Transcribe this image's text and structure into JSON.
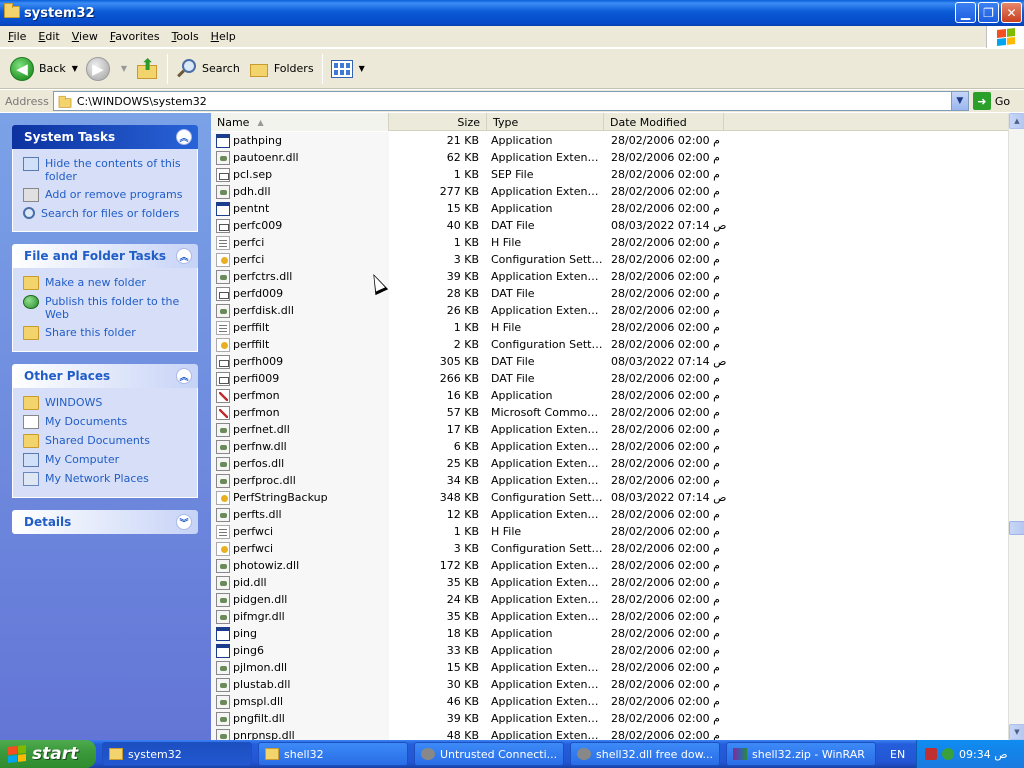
{
  "window": {
    "title": "system32"
  },
  "menu": [
    "File",
    "Edit",
    "View",
    "Favorites",
    "Tools",
    "Help"
  ],
  "toolbar": {
    "back_label": "Back",
    "search_label": "Search",
    "folders_label": "Folders"
  },
  "address": {
    "label": "Address",
    "value": "C:\\WINDOWS\\system32",
    "go_label": "Go"
  },
  "taskpane": {
    "system_tasks": {
      "title": "System Tasks",
      "items": [
        "Hide the contents of this folder",
        "Add or remove programs",
        "Search for files or folders"
      ]
    },
    "file_folder_tasks": {
      "title": "File and Folder Tasks",
      "items": [
        "Make a new folder",
        "Publish this folder to the Web",
        "Share this folder"
      ]
    },
    "other_places": {
      "title": "Other Places",
      "items": [
        "WINDOWS",
        "My Documents",
        "Shared Documents",
        "My Computer",
        "My Network Places"
      ]
    },
    "details": {
      "title": "Details"
    }
  },
  "columns": {
    "name": "Name",
    "size": "Size",
    "type": "Type",
    "date": "Date Modified"
  },
  "files": [
    {
      "icon": "app",
      "name": "pathping",
      "size": "21 KB",
      "type": "Application",
      "date": "28/02/2006 02:00 م"
    },
    {
      "icon": "dll",
      "name": "pautoenr.dll",
      "size": "62 KB",
      "type": "Application Extension",
      "date": "28/02/2006 02:00 م"
    },
    {
      "icon": "gen",
      "name": "pcl.sep",
      "size": "1 KB",
      "type": "SEP File",
      "date": "28/02/2006 02:00 م"
    },
    {
      "icon": "dll",
      "name": "pdh.dll",
      "size": "277 KB",
      "type": "Application Extension",
      "date": "28/02/2006 02:00 م"
    },
    {
      "icon": "app",
      "name": "pentnt",
      "size": "15 KB",
      "type": "Application",
      "date": "28/02/2006 02:00 م"
    },
    {
      "icon": "gen",
      "name": "perfc009",
      "size": "40 KB",
      "type": "DAT File",
      "date": "08/03/2022 07:14 ص"
    },
    {
      "icon": "txt",
      "name": "perfci",
      "size": "1 KB",
      "type": "H File",
      "date": "28/02/2006 02:00 م"
    },
    {
      "icon": "ini",
      "name": "perfci",
      "size": "3 KB",
      "type": "Configuration Settings",
      "date": "28/02/2006 02:00 م"
    },
    {
      "icon": "dll",
      "name": "perfctrs.dll",
      "size": "39 KB",
      "type": "Application Extension",
      "date": "28/02/2006 02:00 م"
    },
    {
      "icon": "gen",
      "name": "perfd009",
      "size": "28 KB",
      "type": "DAT File",
      "date": "28/02/2006 02:00 م"
    },
    {
      "icon": "dll",
      "name": "perfdisk.dll",
      "size": "26 KB",
      "type": "Application Extension",
      "date": "28/02/2006 02:00 م"
    },
    {
      "icon": "txt",
      "name": "perffilt",
      "size": "1 KB",
      "type": "H File",
      "date": "28/02/2006 02:00 م"
    },
    {
      "icon": "ini",
      "name": "perffilt",
      "size": "2 KB",
      "type": "Configuration Settings",
      "date": "28/02/2006 02:00 م"
    },
    {
      "icon": "gen",
      "name": "perfh009",
      "size": "305 KB",
      "type": "DAT File",
      "date": "08/03/2022 07:14 ص"
    },
    {
      "icon": "gen",
      "name": "perfi009",
      "size": "266 KB",
      "type": "DAT File",
      "date": "28/02/2006 02:00 م"
    },
    {
      "icon": "msc",
      "name": "perfmon",
      "size": "16 KB",
      "type": "Application",
      "date": "28/02/2006 02:00 م"
    },
    {
      "icon": "msc",
      "name": "perfmon",
      "size": "57 KB",
      "type": "Microsoft Common ...",
      "date": "28/02/2006 02:00 م"
    },
    {
      "icon": "dll",
      "name": "perfnet.dll",
      "size": "17 KB",
      "type": "Application Extension",
      "date": "28/02/2006 02:00 م"
    },
    {
      "icon": "dll",
      "name": "perfnw.dll",
      "size": "6 KB",
      "type": "Application Extension",
      "date": "28/02/2006 02:00 م"
    },
    {
      "icon": "dll",
      "name": "perfos.dll",
      "size": "25 KB",
      "type": "Application Extension",
      "date": "28/02/2006 02:00 م"
    },
    {
      "icon": "dll",
      "name": "perfproc.dll",
      "size": "34 KB",
      "type": "Application Extension",
      "date": "28/02/2006 02:00 م"
    },
    {
      "icon": "ini",
      "name": "PerfStringBackup",
      "size": "348 KB",
      "type": "Configuration Settings",
      "date": "08/03/2022 07:14 ص"
    },
    {
      "icon": "dll",
      "name": "perfts.dll",
      "size": "12 KB",
      "type": "Application Extension",
      "date": "28/02/2006 02:00 م"
    },
    {
      "icon": "txt",
      "name": "perfwci",
      "size": "1 KB",
      "type": "H File",
      "date": "28/02/2006 02:00 م"
    },
    {
      "icon": "ini",
      "name": "perfwci",
      "size": "3 KB",
      "type": "Configuration Settings",
      "date": "28/02/2006 02:00 م"
    },
    {
      "icon": "dll",
      "name": "photowiz.dll",
      "size": "172 KB",
      "type": "Application Extension",
      "date": "28/02/2006 02:00 م"
    },
    {
      "icon": "dll",
      "name": "pid.dll",
      "size": "35 KB",
      "type": "Application Extension",
      "date": "28/02/2006 02:00 م"
    },
    {
      "icon": "dll",
      "name": "pidgen.dll",
      "size": "24 KB",
      "type": "Application Extension",
      "date": "28/02/2006 02:00 م"
    },
    {
      "icon": "dll",
      "name": "pifmgr.dll",
      "size": "35 KB",
      "type": "Application Extension",
      "date": "28/02/2006 02:00 م"
    },
    {
      "icon": "app",
      "name": "ping",
      "size": "18 KB",
      "type": "Application",
      "date": "28/02/2006 02:00 م"
    },
    {
      "icon": "app",
      "name": "ping6",
      "size": "33 KB",
      "type": "Application",
      "date": "28/02/2006 02:00 م"
    },
    {
      "icon": "dll",
      "name": "pjlmon.dll",
      "size": "15 KB",
      "type": "Application Extension",
      "date": "28/02/2006 02:00 م"
    },
    {
      "icon": "dll",
      "name": "plustab.dll",
      "size": "30 KB",
      "type": "Application Extension",
      "date": "28/02/2006 02:00 م"
    },
    {
      "icon": "dll",
      "name": "pmspl.dll",
      "size": "46 KB",
      "type": "Application Extension",
      "date": "28/02/2006 02:00 م"
    },
    {
      "icon": "dll",
      "name": "pngfilt.dll",
      "size": "39 KB",
      "type": "Application Extension",
      "date": "28/02/2006 02:00 م"
    },
    {
      "icon": "dll",
      "name": "pnrpnsp.dll",
      "size": "48 KB",
      "type": "Application Extension",
      "date": "28/02/2006 02:00 م"
    }
  ],
  "taskbar": {
    "start_label": "start",
    "buttons": [
      {
        "icon": "folder",
        "label": "system32"
      },
      {
        "icon": "folder",
        "label": "shell32"
      },
      {
        "icon": "ie",
        "label": "Untrusted Connecti..."
      },
      {
        "icon": "ie",
        "label": "shell32.dll free dow..."
      },
      {
        "icon": "rar",
        "label": "shell32.zip - WinRAR"
      }
    ],
    "language": "EN",
    "clock": "09:34 ص"
  }
}
